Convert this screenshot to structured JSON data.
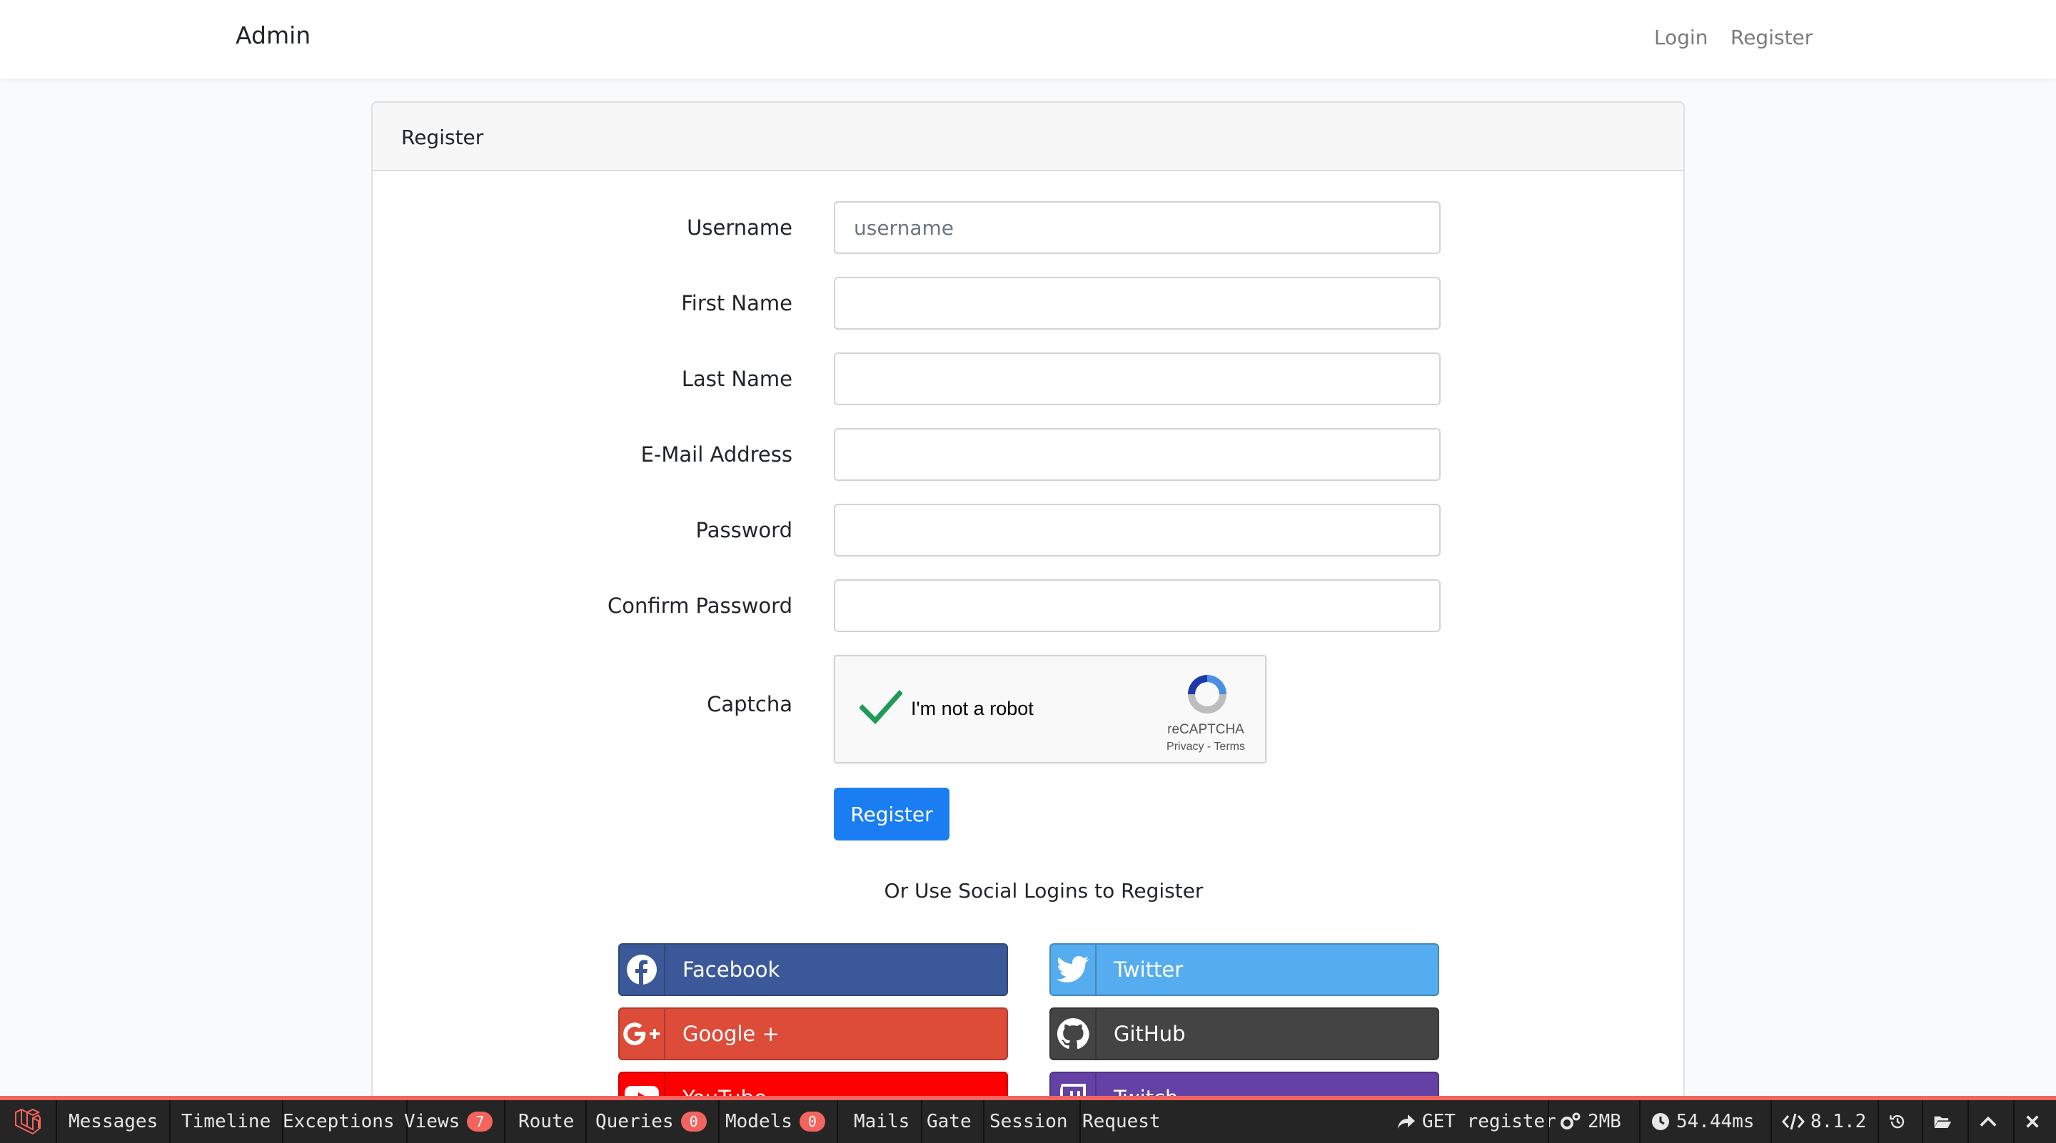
{
  "navbar": {
    "brand": "Admin",
    "login": "Login",
    "register": "Register"
  },
  "card": {
    "header": "Register"
  },
  "form": {
    "username_label": "Username",
    "username_placeholder": "username",
    "first_name_label": "First Name",
    "last_name_label": "Last Name",
    "email_label": "E-Mail Address",
    "password_label": "Password",
    "confirm_password_label": "Confirm Password",
    "captcha_label": "Captcha",
    "submit": "Register"
  },
  "captcha": {
    "text": "I'm not a robot",
    "brand": "reCAPTCHA",
    "links": "Privacy - Terms",
    "checked": true
  },
  "social": {
    "heading": "Or Use Social Logins to Register",
    "facebook": "Facebook",
    "twitter": "Twitter",
    "google": "Google +",
    "github": "GitHub",
    "youtube": "YouTube",
    "twitch": "Twitch"
  },
  "debugbar": {
    "messages": "Messages",
    "timeline": "Timeline",
    "exceptions": "Exceptions",
    "views": "Views",
    "views_count": "7",
    "route": "Route",
    "queries": "Queries",
    "queries_count": "0",
    "models": "Models",
    "models_count": "0",
    "mails": "Mails",
    "gate": "Gate",
    "session": "Session",
    "request": "Request",
    "route_info": "GET register",
    "memory": "2MB",
    "time": "54.44ms",
    "php_version": "8.1.2"
  },
  "colors": {
    "primary": "#1a7ef2",
    "facebook": "#3b5998",
    "twitter": "#55acee",
    "google": "#dd4b39",
    "github": "#444444",
    "youtube": "#ff0000",
    "twitch": "#6441a5",
    "debugbar_accent": "#f4645f"
  }
}
